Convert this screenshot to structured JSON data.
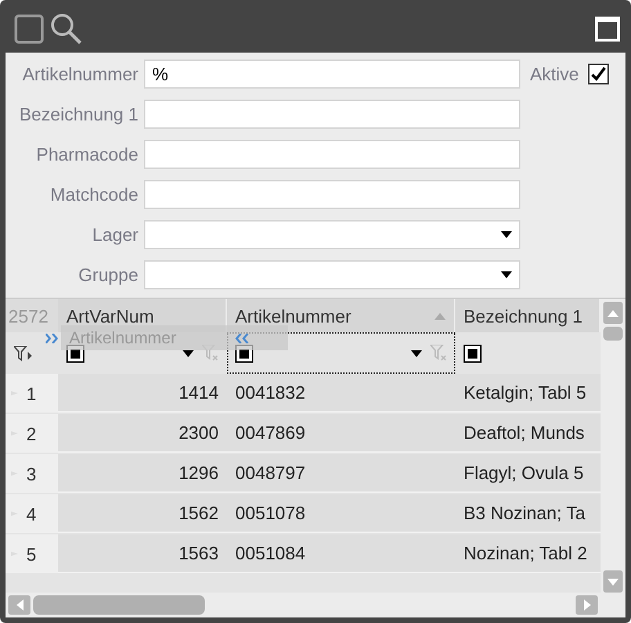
{
  "form": {
    "fields": [
      {
        "label": "Artikelnummer",
        "kind": "text",
        "value": "%"
      },
      {
        "label": "Bezeichnung 1",
        "kind": "text"
      },
      {
        "label": "Pharmacode",
        "kind": "text"
      },
      {
        "label": "Matchcode",
        "kind": "text"
      },
      {
        "label": "Lager",
        "kind": "select"
      },
      {
        "label": "Gruppe",
        "kind": "select"
      }
    ],
    "active": {
      "label": "Aktive",
      "checked": true
    }
  },
  "grid": {
    "corner_text": "2572",
    "drag_ghost": {
      "label": "Artikelnummer"
    },
    "columns": [
      {
        "label": "ArtVarNum",
        "right_aligned": true,
        "sorted_ascending": false,
        "filter_dropdown": true,
        "focused": false
      },
      {
        "label": "Artikelnummer",
        "right_aligned": false,
        "sorted_ascending": true,
        "filter_dropdown": true,
        "focused": true
      },
      {
        "label": "Bezeichnung 1",
        "right_aligned": false,
        "sorted_ascending": false,
        "filter_dropdown": false,
        "focused": false
      }
    ],
    "rows": [
      {
        "number": "1",
        "cells": [
          "1414",
          "0041832",
          "Ketalgin; Tabl 5"
        ]
      },
      {
        "number": "2",
        "cells": [
          "2300",
          "0047869",
          "Deaftol; Munds"
        ]
      },
      {
        "number": "3",
        "cells": [
          "1296",
          "0048797",
          "Flagyl; Ovula 5"
        ]
      },
      {
        "number": "4",
        "cells": [
          "1562",
          "0051078",
          "B3 Nozinan; Ta"
        ]
      },
      {
        "number": "5",
        "cells": [
          "1563",
          "0051084",
          "Nozinan; Tabl 2"
        ]
      }
    ]
  }
}
